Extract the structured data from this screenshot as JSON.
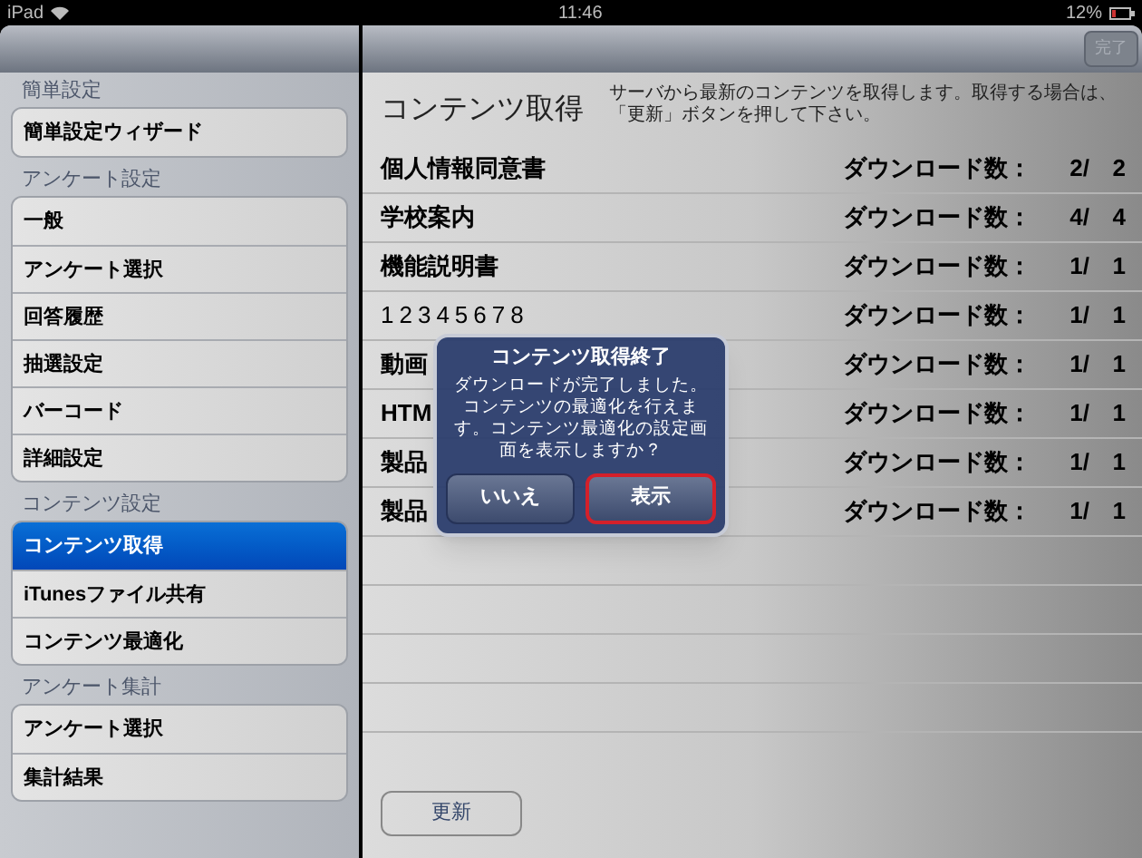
{
  "status_bar": {
    "device": "iPad",
    "time": "11:46",
    "battery": "12%"
  },
  "toolbar": {
    "done_button": {
      "label": "完了",
      "disabled": true
    }
  },
  "sidebar": {
    "sections": [
      {
        "title": "簡単設定",
        "items": [
          {
            "label": "簡単設定ウィザード",
            "selected": false
          }
        ]
      },
      {
        "title": "アンケート設定",
        "items": [
          {
            "label": "一般",
            "selected": false
          },
          {
            "label": "アンケート選択",
            "selected": false
          },
          {
            "label": "回答履歴",
            "selected": false
          },
          {
            "label": "抽選設定",
            "selected": false
          },
          {
            "label": "バーコード",
            "selected": false
          },
          {
            "label": "詳細設定",
            "selected": false
          }
        ]
      },
      {
        "title": "コンテンツ設定",
        "items": [
          {
            "label": "コンテンツ取得",
            "selected": true
          },
          {
            "label": "iTunesファイル共有",
            "selected": false
          },
          {
            "label": "コンテンツ最適化",
            "selected": false
          }
        ]
      },
      {
        "title": "アンケート集計",
        "items": [
          {
            "label": "アンケート選択",
            "selected": false
          },
          {
            "label": "集計結果",
            "selected": false
          }
        ]
      }
    ]
  },
  "content": {
    "title": "コンテンツ取得",
    "description": "サーバから最新のコンテンツを取得します。取得する場合は、「更新」ボタンを押して下さい。",
    "rows": [
      {
        "name": "個人情報同意書",
        "label": "ダウンロード数：",
        "done": "2/",
        "total": "2"
      },
      {
        "name": "学校案内",
        "label": "ダウンロード数：",
        "done": "4/",
        "total": "4"
      },
      {
        "name": "機能説明書",
        "label": "ダウンロード数：",
        "done": "1/",
        "total": "1"
      },
      {
        "name": "12345678",
        "label": "ダウンロード数：",
        "done": "1/",
        "total": "1"
      },
      {
        "name": "動画",
        "label": "ダウンロード数：",
        "done": "1/",
        "total": "1"
      },
      {
        "name": "HTM",
        "label": "ダウンロード数：",
        "done": "1/",
        "total": "1"
      },
      {
        "name": "製品",
        "label": "ダウンロード数：",
        "done": "1/",
        "total": "1"
      },
      {
        "name": "製品",
        "label": "ダウンロード数：",
        "done": "1/",
        "total": "1"
      }
    ],
    "update_button": "更新"
  },
  "dialog": {
    "title": "コンテンツ取得終了",
    "message": "ダウンロードが完了しました。コンテンツの最適化を行えます。コンテンツ最適化の設定画面を表示しますか？",
    "buttons": [
      {
        "label": "いいえ",
        "selected": false
      },
      {
        "label": "表示",
        "selected": true
      }
    ]
  }
}
